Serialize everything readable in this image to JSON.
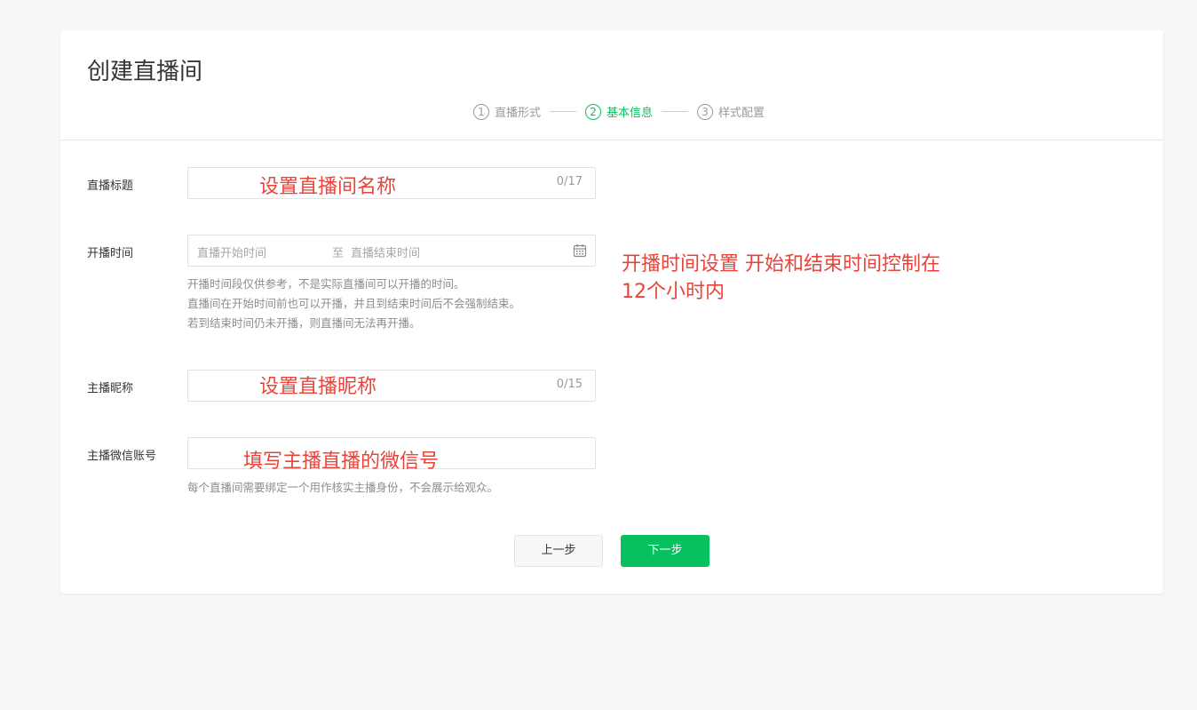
{
  "page": {
    "title": "创建直播间"
  },
  "steps": [
    {
      "num": "1",
      "label": "直播形式"
    },
    {
      "num": "2",
      "label": "基本信息"
    },
    {
      "num": "3",
      "label": "样式配置"
    }
  ],
  "form": {
    "title": {
      "label": "直播标题",
      "counter": "0/17"
    },
    "time": {
      "label": "开播时间",
      "start_placeholder": "直播开始时间",
      "separator": "至",
      "end_placeholder": "直播结束时间",
      "hints": [
        "开播时间段仅供参考，不是实际直播间可以开播的时间。",
        "直播间在开始时间前也可以开播，并且到结束时间后不会强制结束。",
        "若到结束时间仍未开播，则直播间无法再开播。"
      ]
    },
    "anchor_name": {
      "label": "主播昵称",
      "counter": "0/15"
    },
    "anchor_wechat": {
      "label": "主播微信账号",
      "hint": "每个直播间需要绑定一个用作核实主播身份，不会展示给观众。"
    }
  },
  "annotations": {
    "title": "设置直播间名称",
    "time_line1": "开播时间设置 开始和结束时间控制在",
    "time_line2": "12个小时内",
    "anchor_name": "设置直播昵称",
    "anchor_wechat": "填写主播直播的微信号"
  },
  "buttons": {
    "prev": "上一步",
    "next": "下一步"
  },
  "colors": {
    "accent": "#07c160",
    "annotation": "#e8443a"
  },
  "icons": {
    "date_picker": "calendar-icon"
  }
}
